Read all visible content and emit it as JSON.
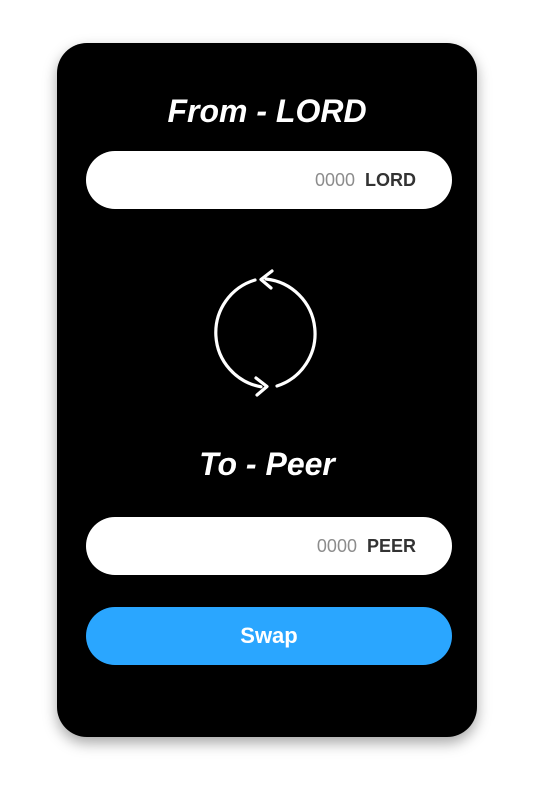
{
  "from": {
    "title": "From - LORD",
    "amount_placeholder": "0000",
    "unit": "LORD"
  },
  "swap_icon": {
    "name": "swap-arrows-icon",
    "color": "#ffffff"
  },
  "to": {
    "title": "To - Peer",
    "amount_placeholder": "0000",
    "unit": "PEER"
  },
  "actions": {
    "swap_label": "Swap",
    "button_color": "#2aa6ff"
  },
  "theme": {
    "card_background": "#000000",
    "field_background": "#ffffff"
  }
}
